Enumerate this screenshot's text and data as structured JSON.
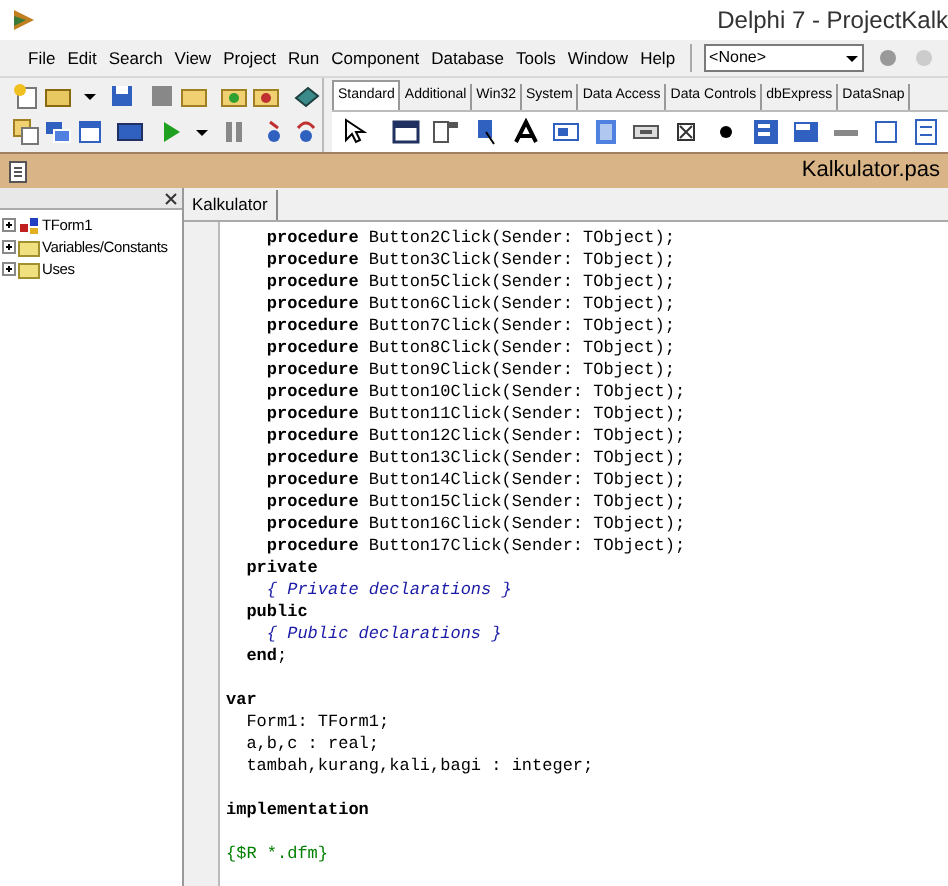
{
  "window": {
    "title": "Delphi 7 - ProjectKalk"
  },
  "menu": [
    "File",
    "Edit",
    "Search",
    "View",
    "Project",
    "Run",
    "Component",
    "Database",
    "Tools",
    "Window",
    "Help"
  ],
  "combo": {
    "value": "<None>"
  },
  "palette_tabs": [
    {
      "label": "Standard",
      "selected": true
    },
    {
      "label": "Additional",
      "selected": false
    },
    {
      "label": "Win32",
      "selected": false
    },
    {
      "label": "System",
      "selected": false
    },
    {
      "label": "Data Access",
      "selected": false
    },
    {
      "label": "Data Controls",
      "selected": false
    },
    {
      "label": "dbExpress",
      "selected": false
    },
    {
      "label": "DataSnap",
      "selected": false
    }
  ],
  "editor": {
    "title": "Kalkulator.pas",
    "tabs": [
      {
        "label": "Kalkulator",
        "selected": true
      }
    ]
  },
  "explorer": {
    "items": [
      {
        "label": "TForm1",
        "kind": "class"
      },
      {
        "label": "Variables/Constants",
        "kind": "folder"
      },
      {
        "label": "Uses",
        "kind": "folder"
      }
    ]
  },
  "code_blocks": [
    [
      [
        {
          "kind": "keyword",
          "text": "    procedure"
        },
        {
          "kind": "plain",
          "text": " Button2Click(Sender: TObject);"
        }
      ],
      [
        {
          "kind": "keyword",
          "text": "    procedure"
        },
        {
          "kind": "plain",
          "text": " Button3Click(Sender: TObject);"
        }
      ],
      [
        {
          "kind": "keyword",
          "text": "    procedure"
        },
        {
          "kind": "plain",
          "text": " Button5Click(Sender: TObject);"
        }
      ],
      [
        {
          "kind": "keyword",
          "text": "    procedure"
        },
        {
          "kind": "plain",
          "text": " Button6Click(Sender: TObject);"
        }
      ],
      [
        {
          "kind": "keyword",
          "text": "    procedure"
        },
        {
          "kind": "plain",
          "text": " Button7Click(Sender: TObject);"
        }
      ],
      [
        {
          "kind": "keyword",
          "text": "    procedure"
        },
        {
          "kind": "plain",
          "text": " Button8Click(Sender: TObject);"
        }
      ],
      [
        {
          "kind": "keyword",
          "text": "    procedure"
        },
        {
          "kind": "plain",
          "text": " Button9Click(Sender: TObject);"
        }
      ],
      [
        {
          "kind": "keyword",
          "text": "    procedure"
        },
        {
          "kind": "plain",
          "text": " Button10Click(Sender: TObject);"
        }
      ],
      [
        {
          "kind": "keyword",
          "text": "    procedure"
        },
        {
          "kind": "plain",
          "text": " Button11Click(Sender: TObject);"
        }
      ],
      [
        {
          "kind": "keyword",
          "text": "    procedure"
        },
        {
          "kind": "plain",
          "text": " Button12Click(Sender: TObject);"
        }
      ],
      [
        {
          "kind": "keyword",
          "text": "    procedure"
        },
        {
          "kind": "plain",
          "text": " Button13Click(Sender: TObject);"
        }
      ],
      [
        {
          "kind": "keyword",
          "text": "    procedure"
        },
        {
          "kind": "plain",
          "text": " Button14Click(Sender: TObject);"
        }
      ],
      [
        {
          "kind": "keyword",
          "text": "    procedure"
        },
        {
          "kind": "plain",
          "text": " Button15Click(Sender: TObject);"
        }
      ],
      [
        {
          "kind": "keyword",
          "text": "    procedure"
        },
        {
          "kind": "plain",
          "text": " Button16Click(Sender: TObject);"
        }
      ],
      [
        {
          "kind": "keyword",
          "text": "    procedure"
        },
        {
          "kind": "plain",
          "text": " Button17Click(Sender: TObject);"
        }
      ],
      [
        {
          "kind": "keyword",
          "text": "  private"
        }
      ],
      [
        {
          "kind": "comment",
          "text": "    { Private declarations }"
        }
      ],
      [
        {
          "kind": "keyword",
          "text": "  public"
        }
      ],
      [
        {
          "kind": "comment",
          "text": "    { Public declarations }"
        }
      ],
      [
        {
          "kind": "keyword",
          "text": "  end"
        },
        {
          "kind": "plain",
          "text": ";"
        }
      ]
    ],
    [
      [
        {
          "kind": "keyword",
          "text": "var"
        }
      ],
      [
        {
          "kind": "plain",
          "text": "  Form1: TForm1;"
        }
      ],
      [
        {
          "kind": "plain",
          "text": "  a,b,c : real;"
        }
      ],
      [
        {
          "kind": "plain",
          "text": "  tambah,kurang,kali,bagi : integer;"
        }
      ]
    ],
    [
      [
        {
          "kind": "keyword",
          "text": "implementation"
        }
      ]
    ],
    [
      [
        {
          "kind": "directive",
          "text": "{$R *.dfm}"
        }
      ]
    ]
  ]
}
